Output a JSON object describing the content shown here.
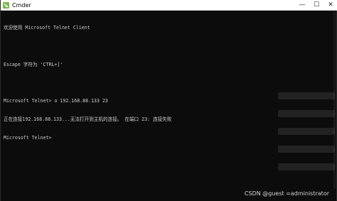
{
  "window": {
    "title": "Cmder",
    "icon": "cmder-lambda-icon",
    "controls": {
      "minimize": "—",
      "maximize": "☐",
      "close": "✕"
    }
  },
  "terminal": {
    "lines": [
      "欢迎使用 Microsoft Telnet Client",
      "",
      "Escape 字符为 'CTRL+]'",
      "",
      "Microsoft Telnet> o 192.168.88.133 23",
      "正在连接192.168.88.133...无法打开到主机的连接。 在端口 23: 连接失败",
      "Microsoft Telnet>"
    ]
  },
  "watermark": "CSDN @guest =administrator"
}
